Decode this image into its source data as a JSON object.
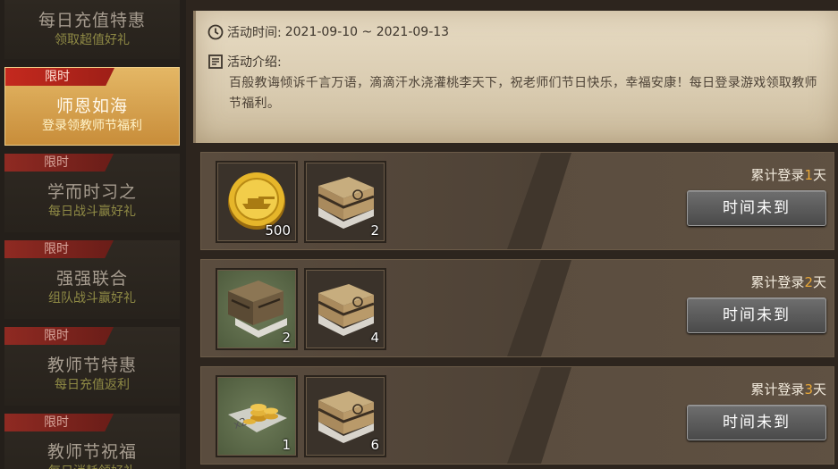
{
  "sidebar": {
    "items": [
      {
        "tag": "",
        "title": "每日充值特惠",
        "subtitle": "领取超值好礼",
        "active": false
      },
      {
        "tag": "限时",
        "title": "师恩如海",
        "subtitle": "登录领教师节福利",
        "active": true
      },
      {
        "tag": "限时",
        "title": "学而时习之",
        "subtitle": "每日战斗赢好礼",
        "active": false
      },
      {
        "tag": "限时",
        "title": "强强联合",
        "subtitle": "组队战斗赢好礼",
        "active": false
      },
      {
        "tag": "限时",
        "title": "教师节特惠",
        "subtitle": "每日充值返利",
        "active": false
      },
      {
        "tag": "限时",
        "title": "教师节祝福",
        "subtitle": "每日消耗领好礼",
        "active": false
      }
    ]
  },
  "info": {
    "time_label": "活动时间:",
    "time_value": "2021-09-10 ~ 2021-09-13",
    "intro_label": "活动介绍:",
    "intro_text": "百般教诲倾诉千言万语，滴滴汗水浇灌桃李天下，祝老师们节日快乐，幸福安康！每日登录游戏领取教师节福利。"
  },
  "rewards": [
    {
      "day_prefix": "累计登录",
      "day_num": "1",
      "day_suffix": "天",
      "button": "时间未到",
      "items": [
        {
          "icon": "gold-coin-icon",
          "count": "500",
          "bg": "dark"
        },
        {
          "icon": "supply-crate-icon",
          "count": "2",
          "bg": "dark"
        }
      ]
    },
    {
      "day_prefix": "累计登录",
      "day_num": "2",
      "day_suffix": "天",
      "button": "时间未到",
      "items": [
        {
          "icon": "military-crate-icon",
          "count": "2",
          "bg": "green"
        },
        {
          "icon": "supply-crate-icon",
          "count": "4",
          "bg": "dark"
        }
      ]
    },
    {
      "day_prefix": "累计登录",
      "day_num": "3",
      "day_suffix": "天",
      "button": "时间未到",
      "items": [
        {
          "icon": "coin-stack-x2-icon",
          "count": "1",
          "bg": "green"
        },
        {
          "icon": "supply-crate-icon",
          "count": "6",
          "bg": "dark"
        }
      ]
    }
  ],
  "colors": {
    "accent_gold": "#e9a838",
    "tag_red": "#c4291e",
    "active_tab": "#d9a453"
  }
}
